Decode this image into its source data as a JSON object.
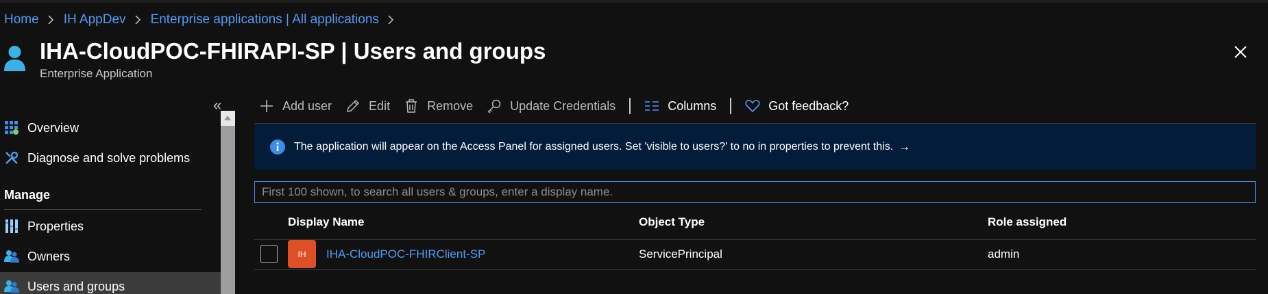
{
  "breadcrumb": [
    "Home",
    "IH AppDev",
    "Enterprise applications | All applications"
  ],
  "header": {
    "title_name": "IHA-CloudPOC-FHIRAPI-SP",
    "title_separator": " | ",
    "title_section": "Users and groups",
    "subtitle": "Enterprise Application"
  },
  "sidebar": {
    "collapse_glyph": "«",
    "section_title": "Manage",
    "items": [
      {
        "label": "Overview",
        "icon": "grid-icon"
      },
      {
        "label": "Diagnose and solve problems",
        "icon": "wrench-icon"
      },
      {
        "label": "Properties",
        "icon": "properties-icon"
      },
      {
        "label": "Owners",
        "icon": "people-icon"
      },
      {
        "label": "Users and groups",
        "icon": "people-icon",
        "selected": true
      }
    ]
  },
  "toolbar": {
    "add_user": "Add user",
    "edit": "Edit",
    "remove": "Remove",
    "update_credentials": "Update Credentials",
    "columns": "Columns",
    "feedback": "Got feedback?"
  },
  "banner": {
    "text": "The application will appear on the Access Panel for assigned users. Set 'visible to users?' to no in properties to prevent this.",
    "arrow": "→"
  },
  "search": {
    "placeholder": "First 100 shown, to search all users & groups, enter a display name.",
    "value": ""
  },
  "table": {
    "columns": [
      "Display Name",
      "Object Type",
      "Role assigned"
    ],
    "rows": [
      {
        "initials": "IH",
        "display_name": "IHA-CloudPOC-FHIRClient-SP",
        "object_type": "ServicePrincipal",
        "role": "admin",
        "checked": false
      }
    ]
  },
  "colors": {
    "background": "#111111",
    "link": "#4f9cf5",
    "banner_bg": "#021c3a",
    "avatar_bg": "#df4f25",
    "selected_nav": "#3b3b3b"
  }
}
